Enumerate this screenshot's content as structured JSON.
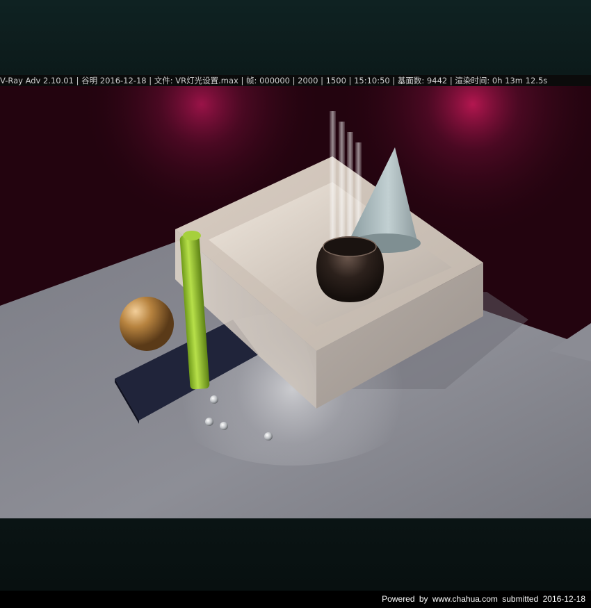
{
  "render_info": {
    "text": "V-Ray Adv 2.10.01 | 谷明 2016-12-18 | 文件: VR灯光设置.max | 帧: 000000 | 2000 | 1500 | 15:10:50 | 基面数: 9442 | 渲染时间:  0h 13m 12.5s"
  },
  "footer": {
    "text": "Powered  by  www.chahua.com  submitted  2016-12-18"
  },
  "scene": {
    "colors": {
      "wall": "#2a0513",
      "floor": "#8e8f96",
      "spotlight": "#c2185b",
      "box": "#d8cfc6",
      "green_rod": "#8fbf2a",
      "gold_sphere": "#b8864a",
      "dark_slab": "#22263a",
      "bowl": "#2a201c",
      "cone": "#aab9bd"
    }
  }
}
